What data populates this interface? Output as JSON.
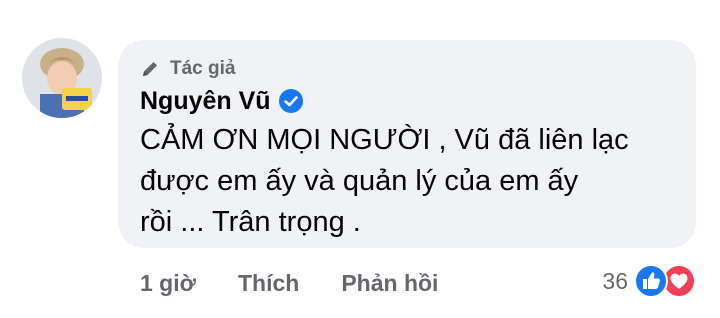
{
  "comment": {
    "author_badge": "Tác giả",
    "author_name": "Nguyên Vũ",
    "text": "CẢM ƠN MỌI NGƯỜI , Vũ đã liên lạc\nđược em ấy và quản lý của em ấy\nrồi ... Trân trọng .",
    "time": "1 giờ",
    "like_label": "Thích",
    "reply_label": "Phản hồi",
    "reaction_count": "36",
    "reactions": [
      "like-icon",
      "love-icon"
    ]
  },
  "colors": {
    "bubble_bg": "#f0f2f5",
    "meta_text": "#65676b",
    "verified_blue": "#1877f2",
    "love_red": "#f33e58"
  }
}
